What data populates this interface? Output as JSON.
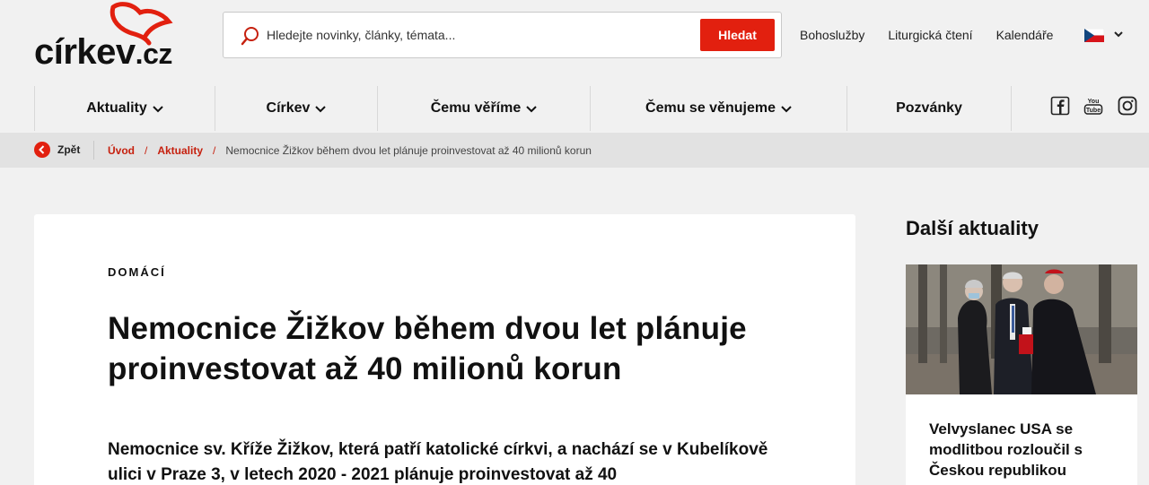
{
  "brand": {
    "logo_main": "církev",
    "logo_tld": ".cz",
    "accent": "#e2200f"
  },
  "search": {
    "placeholder": "Hledejte novinky, články, témata...",
    "button": "Hledat"
  },
  "toplinks": [
    "Bohoslužby",
    "Liturgická čtení",
    "Kalendáře"
  ],
  "language": {
    "flag": "czech-flag-icon"
  },
  "nav": {
    "items": [
      {
        "label": "Aktuality",
        "has_dropdown": true
      },
      {
        "label": "Církev",
        "has_dropdown": true
      },
      {
        "label": "Čemu věříme",
        "has_dropdown": true
      },
      {
        "label": "Čemu se věnujeme",
        "has_dropdown": true
      },
      {
        "label": "Pozvánky",
        "has_dropdown": false
      }
    ],
    "social": [
      "facebook-icon",
      "youtube-icon",
      "instagram-icon"
    ]
  },
  "breadcrumb": {
    "back": "Zpět",
    "items": [
      "Úvod",
      "Aktuality"
    ],
    "current": "Nemocnice Žižkov během dvou let plánuje proinvestovat až 40 milionů korun"
  },
  "article": {
    "category": "DOMÁCÍ",
    "title": "Nemocnice Žižkov během dvou let plánuje proinvestovat až 40 milionů korun",
    "perex": "Nemocnice sv. Kříže Žižkov, která patří katolické církvi, a nachází se v Kubelíkově ulici v Praze 3, v letech 2020 - 2021 plánuje proinvestovat až 40"
  },
  "sidebar": {
    "title": "Další aktuality",
    "card": {
      "headline": "Velvyslanec USA se modlitbou rozloučil s Českou republikou"
    }
  }
}
